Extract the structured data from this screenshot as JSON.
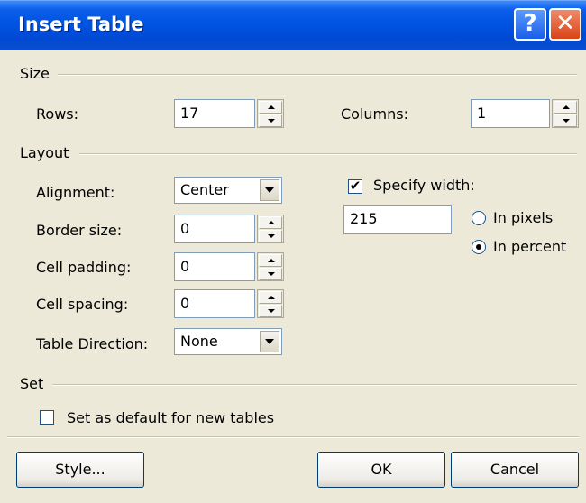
{
  "window": {
    "title": "Insert Table",
    "help_glyph": "?",
    "close_glyph": "✕"
  },
  "size": {
    "group_label": "Size",
    "rows_label": "Rows:",
    "rows_value": "17",
    "columns_label": "Columns:",
    "columns_value": "1"
  },
  "layout": {
    "group_label": "Layout",
    "alignment_label": "Alignment:",
    "alignment_value": "Center",
    "border_label": "Border size:",
    "border_value": "0",
    "padding_label": "Cell padding:",
    "padding_value": "0",
    "spacing_label": "Cell spacing:",
    "spacing_value": "0",
    "direction_label": "Table Direction:",
    "direction_value": "None",
    "specify_width_label": "Specify width:",
    "specify_width_checked": "✔",
    "width_value": "215",
    "pixels_label": "In pixels",
    "percent_label": "In percent",
    "selected_unit": "percent"
  },
  "set": {
    "group_label": "Set",
    "default_label": "Set as default for new tables"
  },
  "buttons": {
    "style": "Style...",
    "ok": "OK",
    "cancel": "Cancel"
  },
  "colors": {
    "titlebar": "#0054e3",
    "dialog_bg": "#ece9d8",
    "close": "#d84418"
  }
}
